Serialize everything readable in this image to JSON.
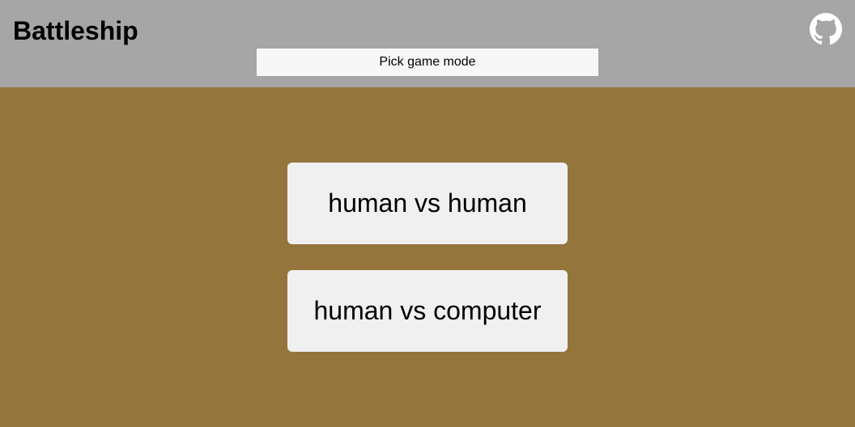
{
  "header": {
    "title": "Battleship",
    "github_icon": "github-icon",
    "status_text": "Pick game mode"
  },
  "modes": [
    {
      "label": "human vs human"
    },
    {
      "label": "human vs computer"
    }
  ],
  "colors": {
    "header_bg": "#a6a6a6",
    "page_bg": "#94753c",
    "button_bg": "#f0f0f0",
    "status_bg": "#f7f7f7"
  }
}
